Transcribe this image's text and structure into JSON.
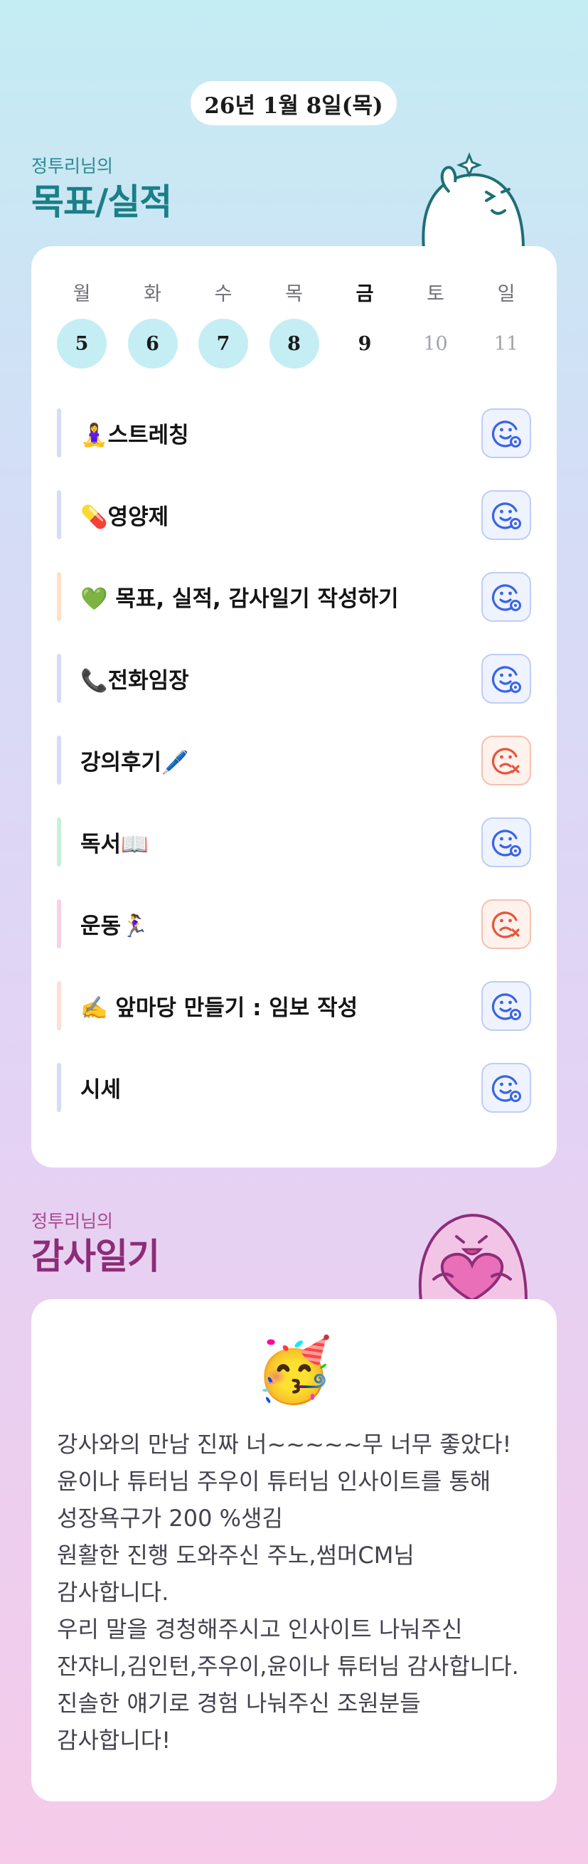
{
  "date_label": "26년 1월 8일(목)",
  "goal_section": {
    "subtitle": "정투리님의",
    "title": "목표/실적"
  },
  "week": [
    {
      "day": "월",
      "date": "5",
      "state": "done"
    },
    {
      "day": "화",
      "date": "6",
      "state": "done"
    },
    {
      "day": "수",
      "date": "7",
      "state": "done"
    },
    {
      "day": "목",
      "date": "8",
      "state": "done"
    },
    {
      "day": "금",
      "date": "9",
      "state": "today"
    },
    {
      "day": "토",
      "date": "10",
      "state": "future"
    },
    {
      "day": "일",
      "date": "11",
      "state": "future"
    }
  ],
  "goals": [
    {
      "label": "🧘‍♀️스트레칭",
      "status": "ok",
      "color": "#d4dcf7"
    },
    {
      "label": "💊영양제",
      "status": "ok",
      "color": "#d4dcf7"
    },
    {
      "label": "💚 목표, 실적, 감사일기 작성하기",
      "status": "ok",
      "color": "#fde0c6"
    },
    {
      "label": "📞전화임장",
      "status": "ok",
      "color": "#d4dcf7"
    },
    {
      "label": "강의후기🖊️",
      "status": "fail",
      "color": "#d4dcf7"
    },
    {
      "label": "독서📖",
      "status": "ok",
      "color": "#c8f0da"
    },
    {
      "label": "운동🏃‍♀️",
      "status": "fail",
      "color": "#f9d2e8"
    },
    {
      "label": "✍️ 앞마당 만들기 : 임보 작성",
      "status": "ok",
      "color": "#fddfd6"
    },
    {
      "label": "시세",
      "status": "ok",
      "color": "#d4dcf7"
    }
  ],
  "status_icons": {
    "ok": "smile-check-icon",
    "fail": "sad-x-icon"
  },
  "colors": {
    "ok_icon": "#3a63e6",
    "fail_icon": "#e6553a",
    "done_circle": "#c4eef4"
  },
  "gratitude_section": {
    "subtitle": "정투리님의",
    "title": "감사일기",
    "emoji": "🥳",
    "paragraphs": [
      "강사와의 만남 진짜 너~~~~~무 너무 좋았다!",
      "윤이나 튜터님 주우이 튜터님 인사이트를 통해 성장욕구가 200 %생김",
      "원활한 진행 도와주신 주노,썸머CM님 감사합니다.",
      "우리 말을 경청해주시고 인사이트 나눠주신 잔쟈니,김인턴,주우이,윤이나 튜터님 감사합니다.",
      "진솔한 얘기로 경험 나눠주신 조원분들 감사합니다!"
    ]
  }
}
